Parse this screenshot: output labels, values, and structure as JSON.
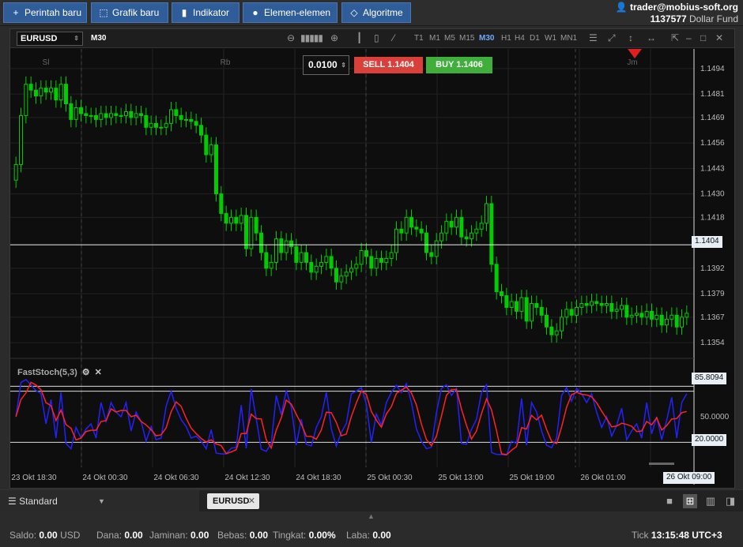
{
  "toolbar": {
    "new_order": "Perintah baru",
    "new_chart": "Grafik baru",
    "indicator": "Indikator",
    "elements": "Elemen-elemen",
    "algorithm": "Algoritme"
  },
  "account": {
    "user": "trader@mobius-soft.org",
    "number": "1137577",
    "fund": "Dollar Fund"
  },
  "chart": {
    "symbol": "EURUSD",
    "timeframe": "M30",
    "timeframes": [
      "T1",
      "M1",
      "M5",
      "M15",
      "M30",
      "H1",
      "H4",
      "D1",
      "W1",
      "MN1"
    ],
    "active_timeframe": "M30",
    "session_labels": [
      "Sl",
      "Rb",
      "Jm"
    ],
    "lot": "0.0100",
    "sell_label": "SELL",
    "sell_price": "1.1404",
    "buy_label": "BUY",
    "buy_price": "1.1406",
    "current_price": "1.1404",
    "stoch_value": "85.8094",
    "stoch_label": "FastStoch(5,3)",
    "stoch_levels": [
      "50.0000",
      "20.0000"
    ],
    "time_cursor": "26 Okt 09:00"
  },
  "chart_data": {
    "type": "candlestick",
    "price_ticks": [
      "1.1494",
      "1.1481",
      "1.1469",
      "1.1456",
      "1.1443",
      "1.1430",
      "1.1418",
      "1.1392",
      "1.1379",
      "1.1367",
      "1.1354"
    ],
    "time_ticks": [
      "23 Okt 18:30",
      "24 Okt 00:30",
      "24 Okt 06:30",
      "24 Okt 12:30",
      "24 Okt 18:30",
      "25 Okt 00:30",
      "25 Okt 13:00",
      "25 Okt 19:00",
      "26 Okt 01:00"
    ],
    "ylim": [
      1.135,
      1.15
    ],
    "close": [
      1.1445,
      1.147,
      1.1486,
      1.1483,
      1.148,
      1.1484,
      1.1482,
      1.1484,
      1.1478,
      1.1486,
      1.1476,
      1.1468,
      1.1474,
      1.1471,
      1.147,
      1.147,
      1.1468,
      1.1471,
      1.1469,
      1.1471,
      1.147,
      1.147,
      1.1472,
      1.1469,
      1.1471,
      1.147,
      1.1464,
      1.1466,
      1.1464,
      1.1464,
      1.1466,
      1.1473,
      1.147,
      1.1468,
      1.1468,
      1.1467,
      1.1465,
      1.146,
      1.145,
      1.1455,
      1.143,
      1.142,
      1.1415,
      1.1418,
      1.1415,
      1.1419,
      1.1402,
      1.1418,
      1.141,
      1.14,
      1.1392,
      1.1395,
      1.1407,
      1.14,
      1.1406,
      1.1403,
      1.1395,
      1.14,
      1.1395,
      1.139,
      1.1393,
      1.1395,
      1.1398,
      1.1392,
      1.1385,
      1.1388,
      1.139,
      1.1392,
      1.1394,
      1.1401,
      1.1398,
      1.1392,
      1.1397,
      1.1395,
      1.1397,
      1.14,
      1.1412,
      1.141,
      1.1418,
      1.1413,
      1.1412,
      1.141,
      1.14,
      1.1398,
      1.1406,
      1.141,
      1.1416,
      1.1413,
      1.1418,
      1.1408,
      1.1407,
      1.141,
      1.1412,
      1.1415,
      1.1425,
      1.1394,
      1.138,
      1.1378,
      1.1372,
      1.1375,
      1.137,
      1.1377,
      1.1365,
      1.1374,
      1.1372,
      1.1368,
      1.1362,
      1.1358,
      1.136,
      1.1367,
      1.1371,
      1.1368,
      1.1372,
      1.1374,
      1.1373,
      1.1375,
      1.1374,
      1.1373,
      1.1374,
      1.137,
      1.1371,
      1.1373,
      1.1367,
      1.1368,
      1.1369,
      1.1367,
      1.137,
      1.1366,
      1.1368,
      1.1363,
      1.1366,
      1.1368,
      1.1362,
      1.1367,
      1.1369
    ]
  },
  "status": {
    "saldo_label": "Saldo:",
    "saldo_value": "0.00",
    "saldo_currency": "USD",
    "dana_label": "Dana:",
    "dana_value": "0.00",
    "jaminan_label": "Jaminan:",
    "jaminan_value": "0.00",
    "bebas_label": "Bebas:",
    "bebas_value": "0.00",
    "tingkat_label": "Tingkat:",
    "tingkat_value": "0.00%",
    "laba_label": "Laba:",
    "laba_value": "0.00",
    "tick_label": "Tick",
    "time": "13:15:48",
    "timezone": "UTC+3"
  },
  "tabs": {
    "layout_name": "Standard",
    "open_symbol": "EURUSD"
  },
  "colors": {
    "toolbar_button": "#2f5d99",
    "candle": "#00cc00",
    "sell": "#d9403a",
    "buy": "#3fae3a",
    "stoch_k": "#2222ff",
    "stoch_d": "#ff2222"
  }
}
